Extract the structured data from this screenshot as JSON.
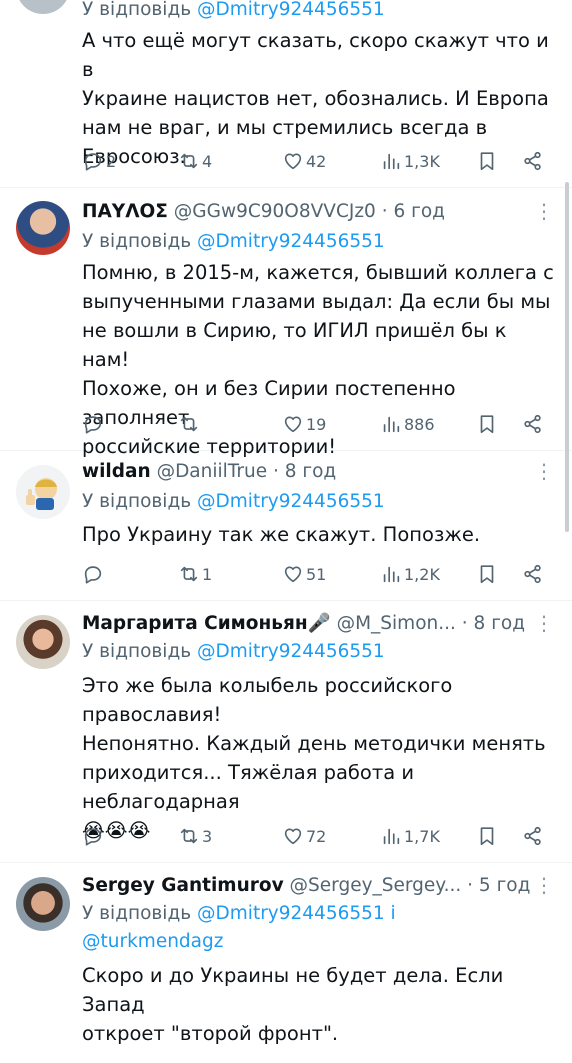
{
  "tweets": [
    {
      "reply_prefix": "У відповідь",
      "reply_to": "@Dmitry924456551",
      "text": "А что ещё могут сказать, скоро скажут что и в\nУкраине нацистов нет, обознались. И Европа\nнам не враг, и мы стремились всегда в\nЕвросоюз.",
      "replies": "2",
      "reposts": "4",
      "likes": "42",
      "views": "1,3K"
    },
    {
      "name": "ΠΑΥΛΟΣ",
      "handle": "@GGw9C90O8VVCJz0",
      "time": "· 6 год",
      "reply_prefix": "У відповідь",
      "reply_to": "@Dmitry924456551",
      "text": "Помню, в 2015-м, кажется, бывший коллега с\nвыпученными глазами выдал: Да если бы мы\nне вошли в Сирию, то ИГИЛ пришёл бы к нам!\nПохоже, он и без Сирии постепенно заполняет\nроссийские территории!",
      "replies": "",
      "reposts": "",
      "likes": "19",
      "views": "886"
    },
    {
      "name": "wildan",
      "handle": "@DaniilTrue",
      "time": "· 8 год",
      "reply_prefix": "У відповідь",
      "reply_to": "@Dmitry924456551",
      "text": "Про Украину так же скажут. Попозже.",
      "replies": "",
      "reposts": "1",
      "likes": "51",
      "views": "1,2K"
    },
    {
      "name": "Маргарита Симоньян🎤",
      "handle": "@M_Simon...",
      "time": "· 8 год",
      "reply_prefix": "У відповідь",
      "reply_to": "@Dmitry924456551",
      "text": "Это же была колыбель российского\nправославия!\nНепонятно. Каждый день методички менять\nприходится... Тяжёлая работа и неблагодарная\n😭😭😭",
      "replies": "",
      "reposts": "3",
      "likes": "72",
      "views": "1,7K"
    },
    {
      "name": "Sergey Gantimurov",
      "handle": "@Sergey_Sergey...",
      "time": "· 5 год",
      "reply_prefix": "У відповідь",
      "reply_to": "@Dmitry924456551 і",
      "reply_to2": "@turkmendagz",
      "text": "Скоро и до Украины не будет дела. Если Запад\nоткроет \"второй фронт\"."
    }
  ],
  "icons": [
    "reply-icon",
    "repost-icon",
    "like-icon",
    "views-icon",
    "bookmark-icon",
    "share-icon",
    "more-icon"
  ],
  "colors": {
    "link": "#1d9bf0",
    "muted": "#536471",
    "text": "#0f1419",
    "divider": "#eff3f4"
  }
}
